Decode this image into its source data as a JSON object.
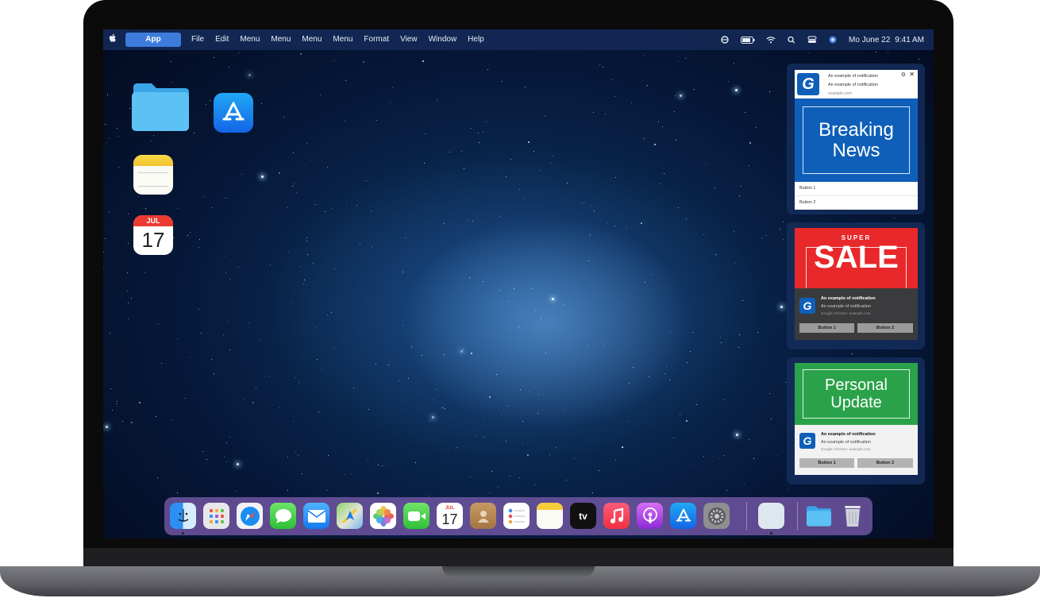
{
  "menubar": {
    "apple": "",
    "app": "App",
    "items": [
      "File",
      "Edit",
      "Menu",
      "Menu",
      "Menu",
      "Menu",
      "Format",
      "View",
      "Window",
      "Help"
    ],
    "date": "Mo June 22",
    "time": "9:41 AM"
  },
  "desktop": {
    "calendar_month": "JUL",
    "calendar_day": "17"
  },
  "notifications": [
    {
      "line1": "An example of notification",
      "line2": "An example of notification",
      "line3": "example.com",
      "banner_text_1": "Breaking",
      "banner_text_2": "News",
      "buttons": [
        "Button 1",
        "Button 2"
      ],
      "banner_color": "#0f5fb8"
    },
    {
      "banner_small": "SUPER",
      "banner_big": "SALE",
      "line1": "An example of notification",
      "line2": "An example of notification",
      "line3": "Google Chrome • example.com",
      "buttons": [
        "Button 1",
        "Button 2"
      ],
      "banner_color": "#e8282b"
    },
    {
      "banner_text_1": "Personal",
      "banner_text_2": "Update",
      "line1": "An example of notification",
      "line2": "An example of notification",
      "line3": "Google Chrome • example.com",
      "buttons": [
        "Button 1",
        "Button 2"
      ],
      "banner_color": "#2aa24a"
    }
  ],
  "dock": {
    "calendar_month": "JUL",
    "calendar_day": "17",
    "tv_label": "tv"
  }
}
